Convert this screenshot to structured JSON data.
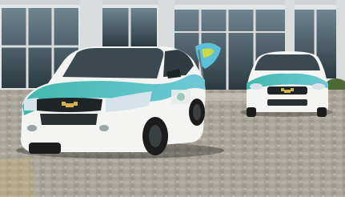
{
  "scene": {
    "car_front": {
      "logo_icon": "chevrolet-bowtie-icon",
      "livery_colors": [
        "#ffffff",
        "#3bb3a6"
      ]
    },
    "car_rear": {
      "logo_icon": "chevrolet-bowtie-icon",
      "livery_colors": [
        "#ffffff",
        "#3bb3a6"
      ]
    },
    "palette": {
      "building_glass": "#3a4a52",
      "building_frame": "#d8dcdc",
      "pavement": "#a9a49a",
      "foliage": "#4c6a32",
      "accent_teal": "#3bb3a6",
      "car_white": "#f4f5f3",
      "tire": "#1c1c1c"
    }
  }
}
